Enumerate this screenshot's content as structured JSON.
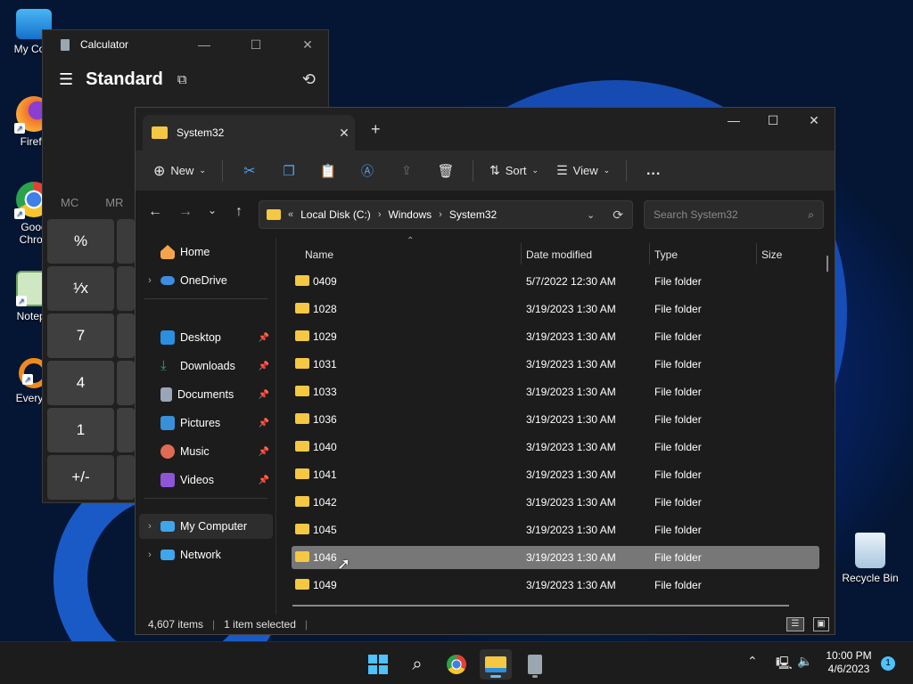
{
  "desktop": {
    "icons": [
      {
        "label": "My Com",
        "icon": "computer-icon"
      },
      {
        "label": "Firefo",
        "icon": "firefox-icon"
      },
      {
        "label": "Goog Chron",
        "icon": "chrome-icon"
      },
      {
        "label": "Notepa",
        "icon": "notepad-icon"
      },
      {
        "label": "Everyth",
        "icon": "everything-icon"
      },
      {
        "label": "Recycle Bin",
        "icon": "recycle-bin-icon"
      }
    ]
  },
  "calculator": {
    "title": "Calculator",
    "mode": "Standard",
    "memory": [
      "MC",
      "MR"
    ],
    "keys": [
      "%",
      "¹⁄x",
      "7",
      "4",
      "1",
      "+/-"
    ]
  },
  "explorer": {
    "tab_title": "System32",
    "toolbar": {
      "new": "New",
      "sort": "Sort",
      "view": "View",
      "more": "..."
    },
    "path": [
      "Local Disk (C:)",
      "Windows",
      "System32"
    ],
    "search_placeholder": "Search System32",
    "nav": {
      "home": "Home",
      "onedrive": "OneDrive",
      "quick": [
        {
          "label": "Desktop",
          "icon": "desktop-folder-icon",
          "color": "#2b8fe0"
        },
        {
          "label": "Downloads",
          "icon": "download-icon",
          "color": "#2aa776"
        },
        {
          "label": "Documents",
          "icon": "documents-icon",
          "color": "#9aa6b8"
        },
        {
          "label": "Pictures",
          "icon": "pictures-icon",
          "color": "#3a8fd9"
        },
        {
          "label": "Music",
          "icon": "music-icon",
          "color": "#e06b55"
        },
        {
          "label": "Videos",
          "icon": "videos-icon",
          "color": "#8e55d9"
        }
      ],
      "computer": "My Computer",
      "network": "Network"
    },
    "columns": {
      "name": "Name",
      "date": "Date modified",
      "type": "Type",
      "size": "Size"
    },
    "rows": [
      {
        "name": "0409",
        "date": "5/7/2022 12:30 AM",
        "type": "File folder"
      },
      {
        "name": "1028",
        "date": "3/19/2023 1:30 AM",
        "type": "File folder"
      },
      {
        "name": "1029",
        "date": "3/19/2023 1:30 AM",
        "type": "File folder"
      },
      {
        "name": "1031",
        "date": "3/19/2023 1:30 AM",
        "type": "File folder"
      },
      {
        "name": "1033",
        "date": "3/19/2023 1:30 AM",
        "type": "File folder"
      },
      {
        "name": "1036",
        "date": "3/19/2023 1:30 AM",
        "type": "File folder"
      },
      {
        "name": "1040",
        "date": "3/19/2023 1:30 AM",
        "type": "File folder"
      },
      {
        "name": "1041",
        "date": "3/19/2023 1:30 AM",
        "type": "File folder"
      },
      {
        "name": "1042",
        "date": "3/19/2023 1:30 AM",
        "type": "File folder"
      },
      {
        "name": "1045",
        "date": "3/19/2023 1:30 AM",
        "type": "File folder"
      },
      {
        "name": "1046",
        "date": "3/19/2023 1:30 AM",
        "type": "File folder",
        "selected": true
      },
      {
        "name": "1049",
        "date": "3/19/2023 1:30 AM",
        "type": "File folder"
      }
    ],
    "status": {
      "count": "4,607 items",
      "selected": "1 item selected"
    }
  },
  "taskbar": {
    "time": "10:00 PM",
    "date": "4/6/2023",
    "notifications": "1"
  }
}
